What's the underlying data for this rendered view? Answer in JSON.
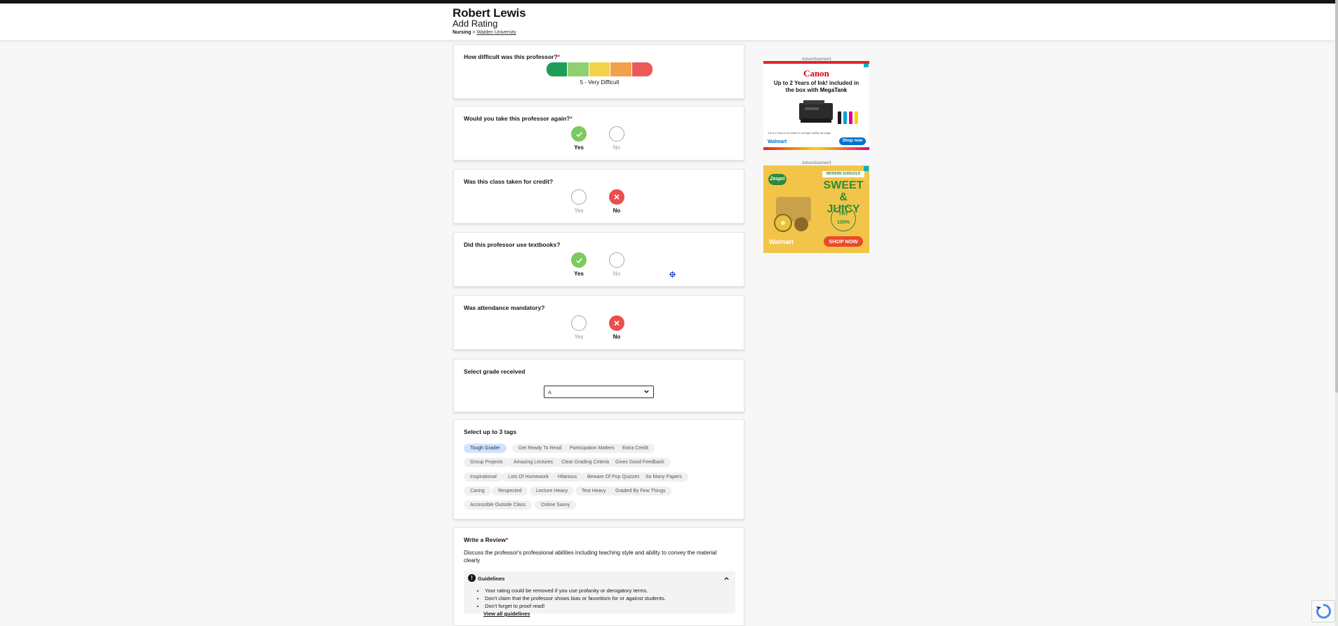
{
  "header": {
    "professor_name": "Robert Lewis",
    "subtitle": "Add Rating",
    "department": "Nursing",
    "separator": ">",
    "school": "Walden University"
  },
  "difficulty": {
    "question": "How difficult was this professor?",
    "required_mark": "*",
    "selected_value": 5,
    "selected_label": "5 - Very Difficult",
    "scale_colors": [
      "#1e9d58",
      "#8fd171",
      "#f3d24a",
      "#f2a04a",
      "#ec5959"
    ]
  },
  "take_again": {
    "question": "Would you take this professor again?",
    "required_mark": "*",
    "yes_label": "Yes",
    "no_label": "No",
    "selected": "Yes"
  },
  "credit": {
    "question": "Was this class taken for credit?",
    "yes_label": "Yes",
    "no_label": "No",
    "selected": "No"
  },
  "textbooks": {
    "question": "Did this professor use textbooks?",
    "yes_label": "Yes",
    "no_label": "No",
    "selected": "Yes"
  },
  "attendance": {
    "question": "Was attendance mandatory?",
    "yes_label": "Yes",
    "no_label": "No",
    "selected": "No"
  },
  "grade": {
    "question": "Select grade received",
    "selected_value": "A"
  },
  "tags": {
    "question": "Select up to 3 tags",
    "items": [
      {
        "label": "Tough Grader",
        "selected": true
      },
      {
        "label": "Get Ready To Read",
        "selected": false
      },
      {
        "label": "Participation Matters",
        "selected": false
      },
      {
        "label": "Extra Credit",
        "selected": false
      },
      {
        "label": "Group Projects",
        "selected": false
      },
      {
        "label": "Amazing Lectures",
        "selected": false
      },
      {
        "label": "Clear Grading Criteria",
        "selected": false
      },
      {
        "label": "Gives Good Feedback",
        "selected": false
      },
      {
        "label": "Inspirational",
        "selected": false
      },
      {
        "label": "Lots Of Homework",
        "selected": false
      },
      {
        "label": "Hilarious",
        "selected": false
      },
      {
        "label": "Beware Of Pop Quizzes",
        "selected": false
      },
      {
        "label": "So Many Papers",
        "selected": false
      },
      {
        "label": "Caring",
        "selected": false
      },
      {
        "label": "Respected",
        "selected": false
      },
      {
        "label": "Lecture Heavy",
        "selected": false
      },
      {
        "label": "Test Heavy",
        "selected": false
      },
      {
        "label": "Graded By Few Things",
        "selected": false
      },
      {
        "label": "Accessible Outside Class",
        "selected": false
      },
      {
        "label": "Online Savvy",
        "selected": false
      }
    ]
  },
  "review": {
    "question": "Write a Review",
    "required_mark": "*",
    "description": "Discuss the professor's professional abilities including teaching style and ability to convey the material clearly",
    "guidelines_title": "Guidelines",
    "guidelines_badge": "!",
    "guidelines": [
      "Your rating could be removed if you use profanity or derogatory terms.",
      "Don't claim that the professor shows bias or favoritism for or against students.",
      "Don't forget to proof read!"
    ],
    "view_all_link": "View all guidelines"
  },
  "ads": {
    "label": "Advertisement",
    "ad1": {
      "brand": "Canon",
      "headline": "Up to 2 Years of Ink! included in the box with",
      "product": "MegaTank",
      "fine_print": "*Up to 2 Years of ink based on average monthly ink usage",
      "store": "Walmart",
      "cta": "Shop now"
    },
    "ad2": {
      "brand": "Zespri",
      "kicker": "MODERN SUNGOLD",
      "headline_line1": "SWEET",
      "headline_line2": "& JUICY",
      "badge_line1": "TRY",
      "badge_line2": "100%",
      "store": "Walmart",
      "cta": "SHOP NOW"
    }
  }
}
